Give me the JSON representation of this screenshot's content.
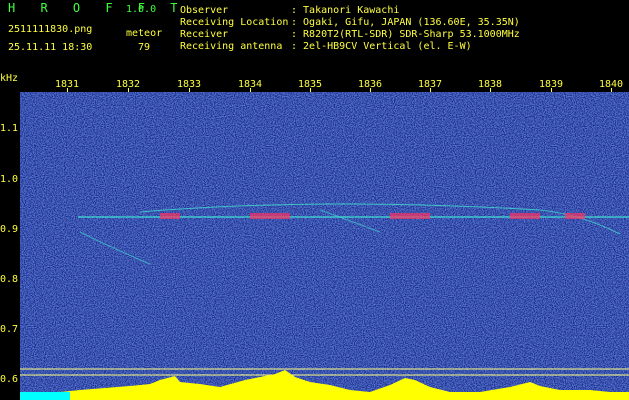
{
  "header": {
    "brand": "H R O F F T",
    "version": "1.0.0",
    "filename": "2511111830.png",
    "timestamp": "25.11.11 18:30",
    "meteor_label": "meteor",
    "meteor_count": "79",
    "fields": [
      {
        "label": "Observer",
        "value": ": Takanori Kawachi"
      },
      {
        "label": "Receiving Location",
        "value": ": Ogaki, Gifu, JAPAN (136.60E, 35.35N)"
      },
      {
        "label": "Receiver",
        "value": ": R820T2(RTL-SDR) SDR-Sharp 53.1000MHz"
      },
      {
        "label": "Receiving antenna",
        "value": ": 2el-HB9CV Vertical (el. E-W)"
      }
    ]
  },
  "x_ticks": [
    "1831",
    "1832",
    "1833",
    "1834",
    "1835",
    "1836",
    "1837",
    "1838",
    "1839",
    "1840"
  ],
  "y_unit": "kHz",
  "y_ticks": [
    "1.1",
    "1.0",
    "0.9",
    "0.8",
    "0.7",
    "0.6"
  ],
  "colors": {
    "background": "#1a2a8c",
    "trace": "#40e0d0",
    "text_green": "#40ff40",
    "text_yellow": "#ffff40",
    "baseline": "#00ffff"
  }
}
